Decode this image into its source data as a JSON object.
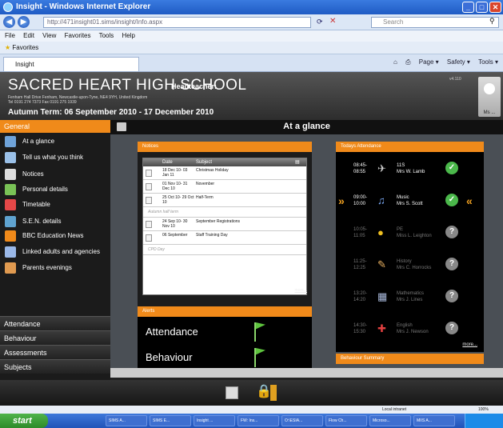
{
  "window": {
    "title": "Insight - Windows Internet Explorer",
    "min": "_",
    "max": "□",
    "close": "✕"
  },
  "address": {
    "url": "http://471insight01.sims/insight/Info.aspx",
    "search_placeholder": "Search"
  },
  "menubar": {
    "items": [
      "File",
      "Edit",
      "View",
      "Favorites",
      "Tools",
      "Help"
    ]
  },
  "favorites": {
    "label": "Favorites"
  },
  "tab": {
    "label": "Insight"
  },
  "commandbar": {
    "items": [
      "Page ▾",
      "Safety ▾",
      "Tools ▾"
    ]
  },
  "header": {
    "school": "SACRED HEART HIGH SCHOOL",
    "headteacher": "Headteacher:",
    "address": "Fenham Hall Drive Fenham, Newcastle-upon-Tyne, NE4 9YH, United Kingdom",
    "tel": "Tel 0191 274 7373   Fax 0191 275 1939",
    "term": "Autumn Term: 06 September 2010 - 17 December 2010",
    "version": "v4.110",
    "user": "Ms ..."
  },
  "sidebar": {
    "general": "General",
    "items": [
      {
        "label": "At a glance",
        "color": "#6fa3d9"
      },
      {
        "label": "Tell us what you think",
        "color": "#9ac0e8"
      },
      {
        "label": "Notices",
        "color": "#dddddd"
      },
      {
        "label": "Personal details",
        "color": "#79c256"
      },
      {
        "label": "Timetable",
        "color": "#e54848"
      },
      {
        "label": "S.E.N. details",
        "color": "#5fa3d0"
      },
      {
        "label": "BBC Education News",
        "color": "#f08a1a"
      },
      {
        "label": "Linked adults and agencies",
        "color": "#9ab8e8"
      },
      {
        "label": "Parents evenings",
        "color": "#e09a50"
      }
    ],
    "sections": [
      "Attendance",
      "Behaviour",
      "Assessments",
      "Subjects"
    ]
  },
  "main": {
    "title": "At a glance",
    "notices": {
      "title": "Notices",
      "columns": [
        "Date",
        "Subject"
      ],
      "rows": [
        {
          "date": "18 Dec 10- 03 Jan 11",
          "subject": "Christmas Holiday"
        },
        {
          "date": "01 Nov 10- 31 Dec 10",
          "subject": "November"
        },
        {
          "date": "25 Oct 10- 29 Oct 10",
          "subject": "Half-Term"
        },
        {
          "sep": "Autumn half term"
        },
        {
          "date": "24 Sep 10- 30 Nov 10",
          "subject": "September Registrations"
        },
        {
          "date": "06 September",
          "subject": "Staff Training Day"
        },
        {
          "sep": "CPD Day"
        }
      ],
      "more": "more..."
    },
    "alerts": {
      "title": "Alerts",
      "items": [
        "Attendance",
        "Behaviour"
      ]
    },
    "attendance": {
      "title": "Todays Attendance",
      "rows": [
        {
          "time": "08:45-\n08:55",
          "subject": "11S\nMrs W. Lamb",
          "status": "✓"
        },
        {
          "time": "09:00-\n10:00",
          "subject": "Music\nMrs S. Scott",
          "status": "✓"
        },
        {
          "time": "10:05-\n11:05",
          "subject": "PE\nMiss L. Leighton",
          "status": "?"
        },
        {
          "time": "11:25-\n12:25",
          "subject": "History\nMrs C. Horrocks",
          "status": "?"
        },
        {
          "time": "13:20-\n14:20",
          "subject": "Mathematics\nMrs J. Lines",
          "status": "?"
        },
        {
          "time": "14:30-\n15:30",
          "subject": "English\nMrs J. Newson",
          "status": "?"
        }
      ],
      "more": "more..."
    },
    "behaviour_summary": {
      "title": "Behaviour Summary"
    }
  },
  "statusbar": {
    "zone": "Local intranet",
    "zoom": "100%"
  },
  "taskbar": {
    "start": "start",
    "tasks": [
      "SIMS A...",
      "SIMS E...",
      "Insight ...",
      "FW: Ins...",
      "O:\\ESIA...",
      "Flow Ch...",
      "Microso...",
      "MIIS A..."
    ]
  }
}
